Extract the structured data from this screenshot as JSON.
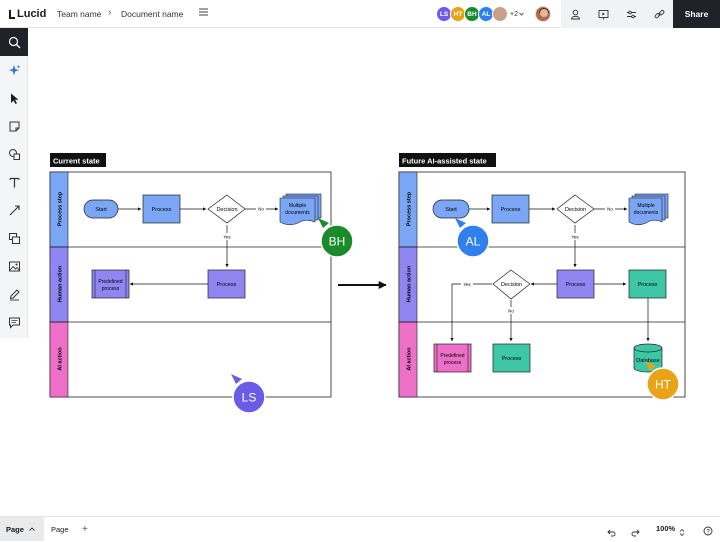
{
  "app": {
    "logo_text": "Lucid"
  },
  "breadcrumb": {
    "team": "Team name",
    "separator": "›",
    "document": "Document name"
  },
  "collaborators": [
    {
      "initials": "LS",
      "color": "#6b5ce7"
    },
    {
      "initials": "HT",
      "color": "#e8a317"
    },
    {
      "initials": "BH",
      "color": "#1a8a2a"
    },
    {
      "initials": "AL",
      "color": "#2f80ed"
    }
  ],
  "collaborators_more": "+2",
  "toolbar": {
    "share_label": "Share",
    "icons": [
      "person-icon",
      "present-icon",
      "settings-sliders-icon",
      "link-icon"
    ]
  },
  "sidebar": {
    "tools": [
      "search-icon",
      "ai-sparkle-icon",
      "pointer-icon",
      "sticky-note-icon",
      "shapes-icon",
      "text-icon",
      "line-icon",
      "container-icon",
      "image-icon",
      "pen-icon",
      "comment-icon"
    ]
  },
  "diagram_left": {
    "title": "Current state",
    "lanes": [
      "Process step",
      "Human action",
      "AI action"
    ],
    "shapes": {
      "start": "Start",
      "process1": "Process",
      "decision": "Decision",
      "multi": [
        "Multiple",
        "documents"
      ],
      "process2": "Process",
      "predefined": [
        "Predefined",
        "process"
      ]
    },
    "edge_labels": {
      "no": "No",
      "yes": "Yes"
    }
  },
  "diagram_right": {
    "title": "Future AI-assisted state",
    "lanes": [
      "Process step",
      "Human action",
      "AI action"
    ],
    "shapes": {
      "start": "Start",
      "process1": "Process",
      "decision1": "Decision",
      "multi": [
        "Multiple",
        "documents"
      ],
      "decision2": "Decision",
      "process2": "Process",
      "process3": "Process",
      "predefined": [
        "Predefined",
        "process"
      ],
      "process4": "Process",
      "database": "Database"
    },
    "edge_labels": {
      "no1": "No",
      "yes1": "Yes",
      "yes2": "Yes",
      "no2": "No"
    }
  },
  "cursors": [
    {
      "initials": "BH",
      "color": "#1a8a2a"
    },
    {
      "initials": "AL",
      "color": "#2f80ed"
    },
    {
      "initials": "LS",
      "color": "#6b5ce7"
    },
    {
      "initials": "HT",
      "color": "#e8a317"
    }
  ],
  "pages": {
    "active": "Page",
    "other": "Page",
    "add": "+"
  },
  "zoom": {
    "value": "100%"
  },
  "colors": {
    "process_step_lane": "#7aa6f5",
    "human_action_lane": "#8f86f2",
    "ai_action_lane": "#ee6fc7",
    "process_shape": "#7aa6f5",
    "human_shape": "#8f86f2",
    "ai_shape": "#ee6fc7",
    "teal_shape": "#3ec7a6",
    "share_bg": "#1f2328"
  }
}
